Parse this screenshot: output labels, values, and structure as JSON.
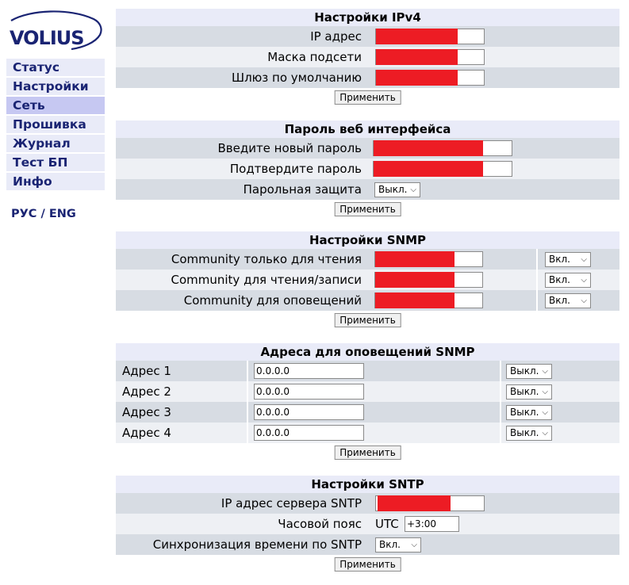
{
  "logo": {
    "text": "VOLIUS"
  },
  "nav": {
    "items": [
      {
        "label": "Статус"
      },
      {
        "label": "Настройки"
      },
      {
        "label": "Сеть"
      },
      {
        "label": "Прошивка"
      },
      {
        "label": "Журнал"
      },
      {
        "label": "Тест БП"
      },
      {
        "label": "Инфо"
      }
    ],
    "active_index": 2,
    "lang": "РУС / ENG"
  },
  "apply_label": "Применить",
  "ipv4": {
    "title": "Настройки IPv4",
    "rows": [
      {
        "label": "IP адрес",
        "value": ""
      },
      {
        "label": "Маска подсети",
        "value": ""
      },
      {
        "label": "Шлюз по умолчанию",
        "value": ""
      }
    ]
  },
  "password": {
    "title": "Пароль веб интерфейса",
    "new_label": "Введите новый пароль",
    "confirm_label": "Подтвердите пароль",
    "protect_label": "Парольная защита",
    "protect_value": "Выкл."
  },
  "snmp": {
    "title": "Настройки SNMP",
    "rows": [
      {
        "label": "Community только для чтения",
        "state": "Вкл."
      },
      {
        "label": "Community для чтения/записи",
        "state": "Вкл."
      },
      {
        "label": "Community для оповещений",
        "state": "Вкл."
      }
    ]
  },
  "snmp_addr": {
    "title": "Адреса для оповещений SNMP",
    "rows": [
      {
        "label": "Адрес 1",
        "value": "0.0.0.0",
        "state": "Выкл."
      },
      {
        "label": "Адрес 2",
        "value": "0.0.0.0",
        "state": "Выкл."
      },
      {
        "label": "Адрес 3",
        "value": "0.0.0.0",
        "state": "Выкл."
      },
      {
        "label": "Адрес 4",
        "value": "0.0.0.0",
        "state": "Выкл."
      }
    ]
  },
  "sntp": {
    "title": "Настройки SNTP",
    "server_label": "IP адрес сервера SNTP",
    "tz_label": "Часовой пояс",
    "tz_prefix": "UTC",
    "tz_value": "+3:00",
    "sync_label": "Синхронизация времени по SNTP",
    "sync_value": "Вкл."
  }
}
